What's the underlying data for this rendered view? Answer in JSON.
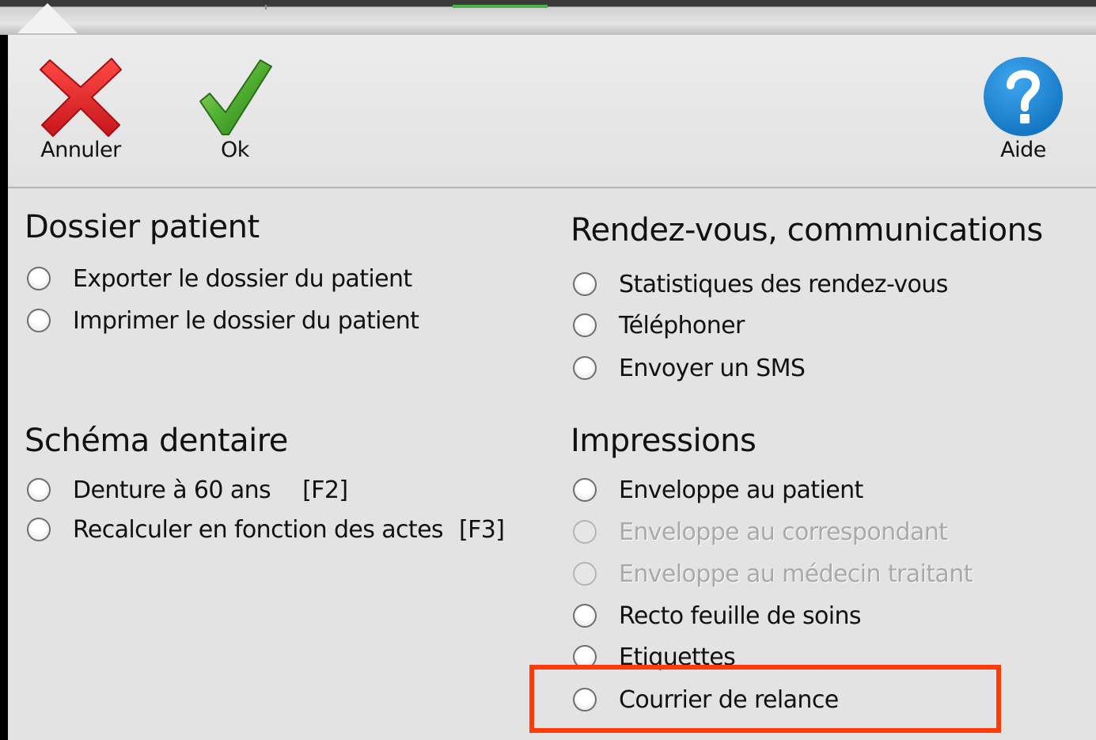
{
  "toolbar": {
    "cancel_label": "Annuler",
    "ok_label": "Ok",
    "help_label": "Aide"
  },
  "sections": {
    "dossier": {
      "title": "Dossier patient",
      "options": [
        "Exporter le dossier du patient",
        "Imprimer le dossier du patient"
      ]
    },
    "schema": {
      "title": "Schéma dentaire",
      "options": [
        {
          "label": "Denture à 60 ans",
          "shortcut": "[F2]"
        },
        {
          "label": "Recalculer en fonction des actes",
          "shortcut": "[F3]"
        }
      ]
    },
    "rdv": {
      "title": "Rendez-vous, communications",
      "options": [
        "Statistiques des rendez-vous",
        "Téléphoner",
        "Envoyer un SMS"
      ]
    },
    "impressions": {
      "title": "Impressions",
      "options": [
        {
          "label": "Enveloppe au patient",
          "enabled": true
        },
        {
          "label": "Enveloppe au correspondant",
          "enabled": false
        },
        {
          "label": "Enveloppe au médecin traitant",
          "enabled": false
        },
        {
          "label": "Recto feuille de soins",
          "enabled": true
        },
        {
          "label": "Etiquettes",
          "enabled": true
        },
        {
          "label": "Courrier de relance",
          "enabled": true
        }
      ]
    }
  },
  "highlighted_option": "Courrier de relance",
  "colors": {
    "highlight": "#ff3b0a",
    "cancel_icon": "#e0242a",
    "ok_icon": "#3f9b2a",
    "help_icon": "#1a86d6",
    "accent_tab": "#49b24a"
  },
  "icons": {
    "cancel": "red-x-icon",
    "ok": "green-check-icon",
    "help": "question-mark-icon"
  }
}
